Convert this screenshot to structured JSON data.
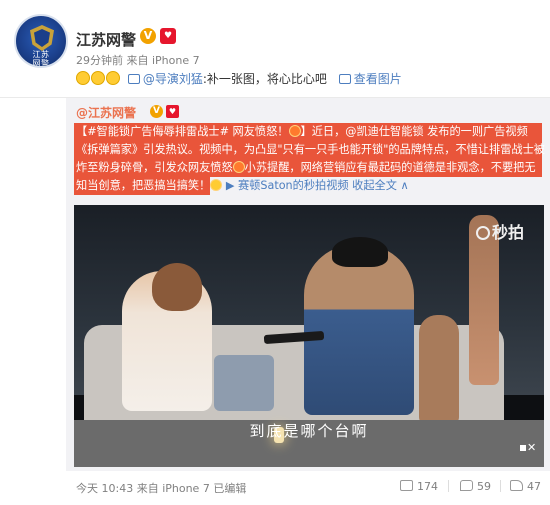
{
  "post": {
    "author": "江苏网警",
    "verified_mark": "V",
    "heart_mark": "♥",
    "avatar_text": "江苏\n网警",
    "meta": "29分钟前 来自 iPhone 7",
    "repost": {
      "mention": "@导演刘猛",
      "text": ":补一张图，将心比心吧",
      "view_pic": "查看图片"
    }
  },
  "card": {
    "author": "@江苏网警",
    "verified_mark": "V",
    "heart_mark": "♥",
    "lines": [
      {
        "a": "【#智能锁广告侮辱排雷战士# 网友愤怒！",
        "b": "】近日，@凯迪仕智能锁 发布的一则广告视频"
      },
      {
        "a": "《拆弹篇家》引发热议。视频中，为凸显\"只有一只手也能开锁\"的品牌特点，不惜让排雷战士被"
      },
      {
        "a": "炸至粉身碎骨，引发众网友愤怒",
        "b": "小苏提醒，网络营销应有最起码的道德是非观念，不要把无"
      },
      {
        "a": "知当创意，把恶搞当搞笑！",
        "tail": "赛顿Saton的秒拍视频",
        "more": " 收起全文 ∧"
      }
    ],
    "video": {
      "watermark": "秒拍",
      "subtitle": "到底是哪个台啊"
    }
  },
  "footer": {
    "meta": "今天 10:43 来自 iPhone 7",
    "edited": "已编辑",
    "repost_count": "174",
    "comment_count": "59",
    "like_count": "47"
  },
  "colors": {
    "highlight": "#e9553a",
    "link_orange": "#eb7350",
    "link_blue": "#4d7ebf",
    "verified": "#f2a200"
  }
}
